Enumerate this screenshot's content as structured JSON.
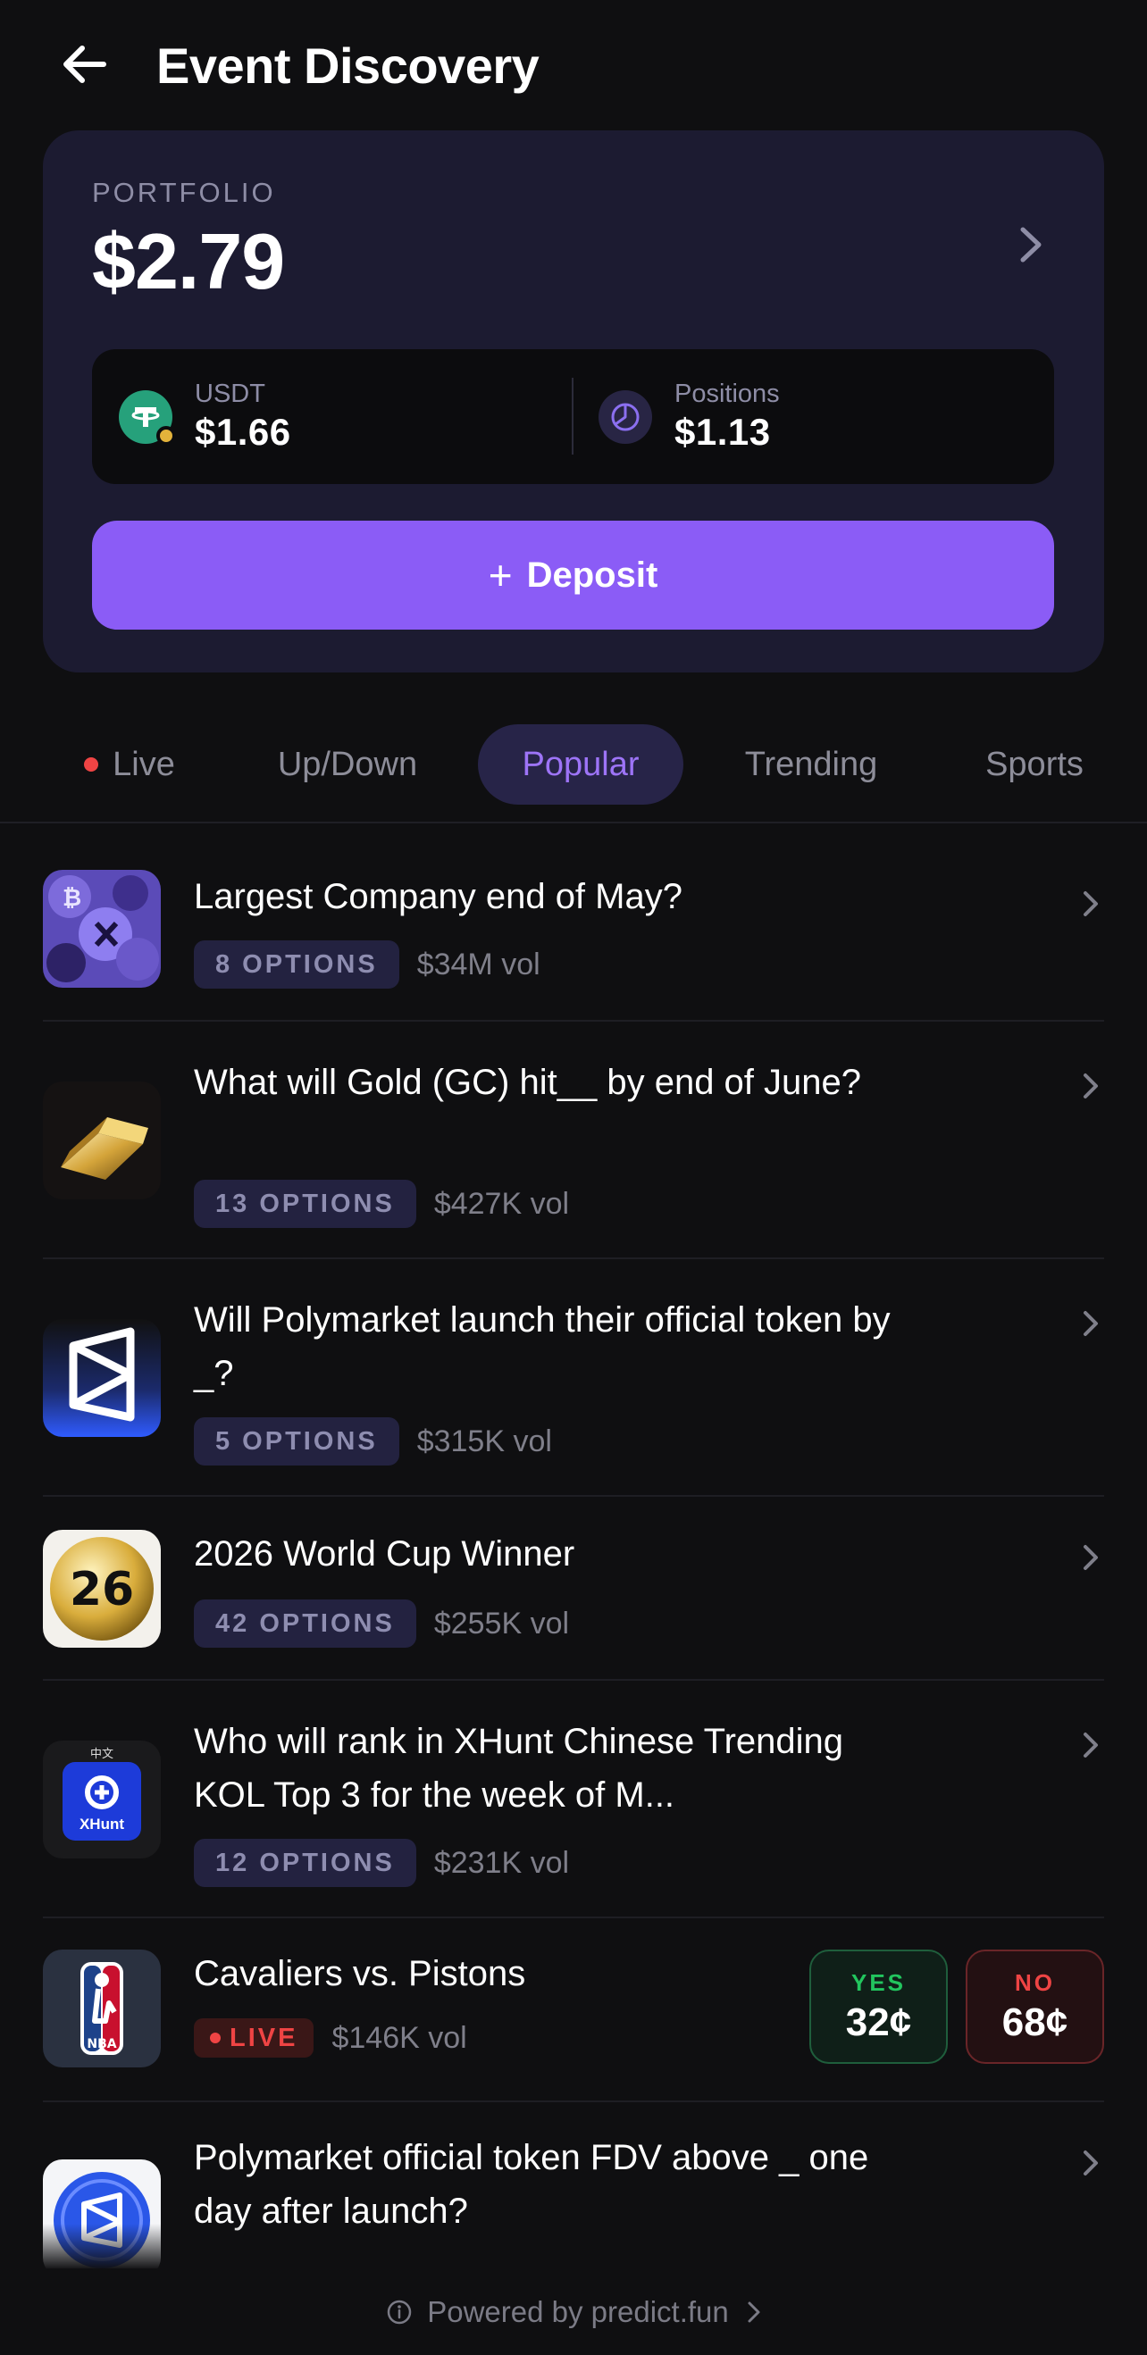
{
  "header": {
    "title": "Event Discovery"
  },
  "portfolio": {
    "label": "PORTFOLIO",
    "value": "$2.79",
    "usdt": {
      "label": "USDT",
      "amount": "$1.66"
    },
    "positions": {
      "label": "Positions",
      "amount": "$1.13"
    },
    "deposit_plus": "+",
    "deposit_label": "Deposit"
  },
  "tabs": [
    {
      "label": "Live",
      "active": false
    },
    {
      "label": "Up/Down",
      "active": false
    },
    {
      "label": "Popular",
      "active": true
    },
    {
      "label": "Trending",
      "active": false
    },
    {
      "label": "Sports",
      "active": false
    }
  ],
  "markets": [
    {
      "title": "Largest Company end of May?",
      "options": "8 OPTIONS",
      "volume": "$34M vol",
      "icon": "crypto-collage-thumbnail"
    },
    {
      "title": "What will Gold (GC) hit__ by end of June?",
      "options": "13 OPTIONS",
      "volume": "$427K vol",
      "icon": "gold-bar-thumbnail"
    },
    {
      "title": "Will Polymarket launch their official token by _?",
      "options": "5 OPTIONS",
      "volume": "$315K vol",
      "icon": "polymarket-logo-thumbnail"
    },
    {
      "title": "2026 World Cup Winner",
      "options": "42 OPTIONS",
      "volume": "$255K vol",
      "icon": "world-cup-26-thumbnail"
    },
    {
      "title": "Who will rank in XHunt Chinese Trending KOL Top 3 for the week of M...",
      "options": "12 OPTIONS",
      "volume": "$231K vol",
      "icon": "xhunt-thumbnail",
      "thumb_tag": "中文",
      "thumb_brand": "XHunt"
    },
    {
      "title": "Cavaliers vs. Pistons",
      "live": "LIVE",
      "volume": "$146K vol",
      "icon": "nba-logo-thumbnail",
      "thumb_brand": "NBA",
      "yes": {
        "label": "YES",
        "price": "32¢"
      },
      "no": {
        "label": "NO",
        "price": "68¢"
      }
    },
    {
      "title": "Polymarket official token FDV above _ one day after launch?",
      "icon": "polymarket-token-thumbnail"
    }
  ],
  "footer": {
    "text": "Powered by predict.fun"
  },
  "colors": {
    "background": "#0f0f11",
    "card": "#1c1b31",
    "accent": "#8b5cf6",
    "yes": "#22c55e",
    "no": "#ef4444"
  }
}
